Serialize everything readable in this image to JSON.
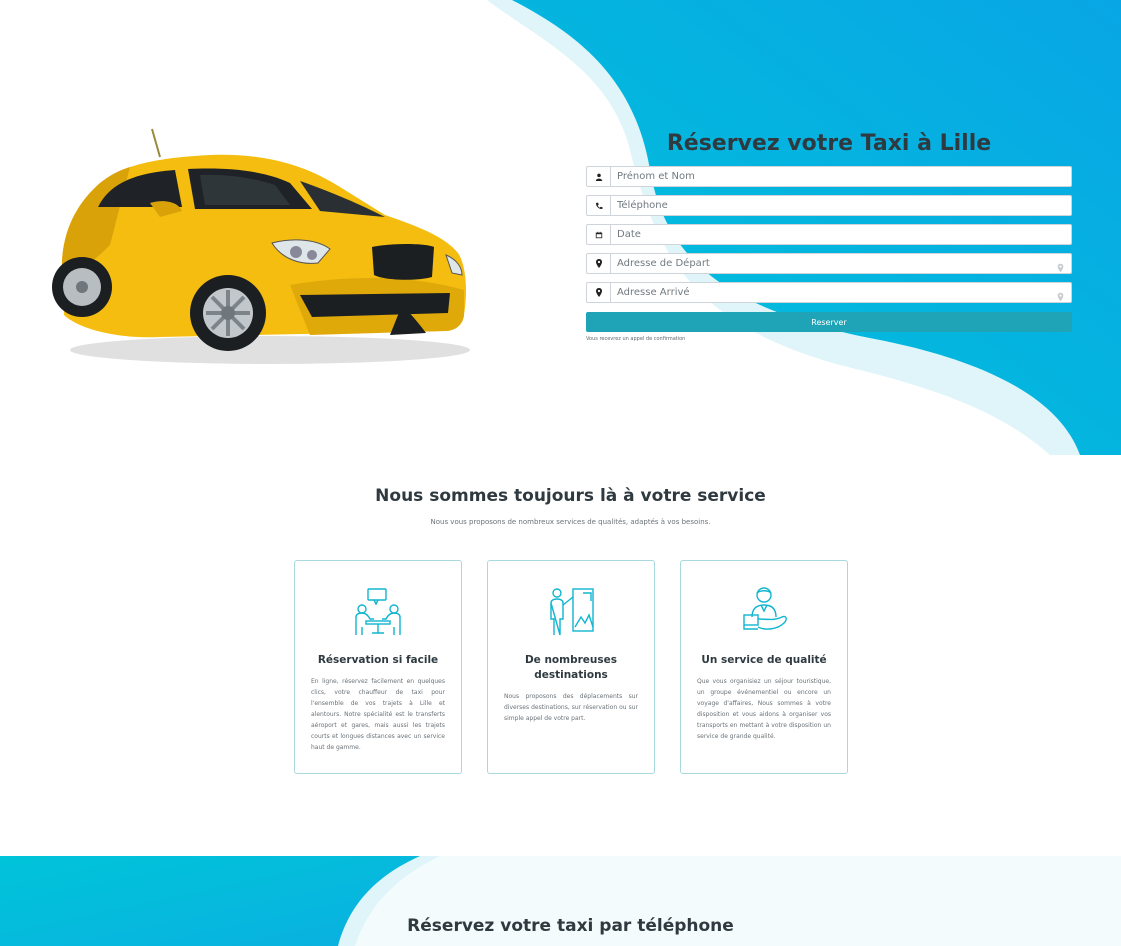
{
  "hero": {
    "title": "Réservez votre Taxi à Lille",
    "fields": {
      "name": {
        "placeholder": "Prénom et Nom",
        "icon": "user-icon"
      },
      "phone": {
        "placeholder": "Téléphone",
        "icon": "phone-icon"
      },
      "date": {
        "placeholder": "Date",
        "icon": "calendar-icon"
      },
      "departure": {
        "placeholder": "Adresse de Départ",
        "icon": "map-pin-icon"
      },
      "arrival": {
        "placeholder": "Adresse Arrivé",
        "icon": "map-pin-icon"
      }
    },
    "submit_label": "Reserver",
    "note": "Vous recevrez un appel de confirmation"
  },
  "services": {
    "title": "Nous sommes toujours là à votre service",
    "subtitle": "Nous vous proposons de nombreux services de qualités, adaptés à vos besoins.",
    "cards": [
      {
        "title": "Réservation si facile",
        "icon": "meeting-icon",
        "text": "En ligne, réservez facilement en quelques clics, votre chauffeur de taxi pour l'ensemble de vos trajets à Lille et alentours. Notre spécialité est le transferts aéroport et gares, mais aussi les trajets courts et longues distances avec un service haut de gamme."
      },
      {
        "title": "De nombreuses destinations",
        "icon": "presentation-icon",
        "text": "Nous proposons des déplacements sur diverses destinations, sur réservation ou sur simple appel de votre part."
      },
      {
        "title": "Un service de qualité",
        "icon": "service-person-icon",
        "text": "Que vous organisiez un séjour touristique, un groupe événementiel ou encore un voyage d'affaires, Nous sommes à votre disposition et vous aidons à organiser vos transports en mettant à votre disposition un service de grande qualité."
      }
    ]
  },
  "phone_section": {
    "title": "Réservez votre taxi par téléphone"
  },
  "colors": {
    "accent": "#1fa3b6",
    "cyan": "#00c2dc",
    "blue": "#0aa8e4",
    "pale": "#dff4f8",
    "taxi": "#f4bd10"
  }
}
